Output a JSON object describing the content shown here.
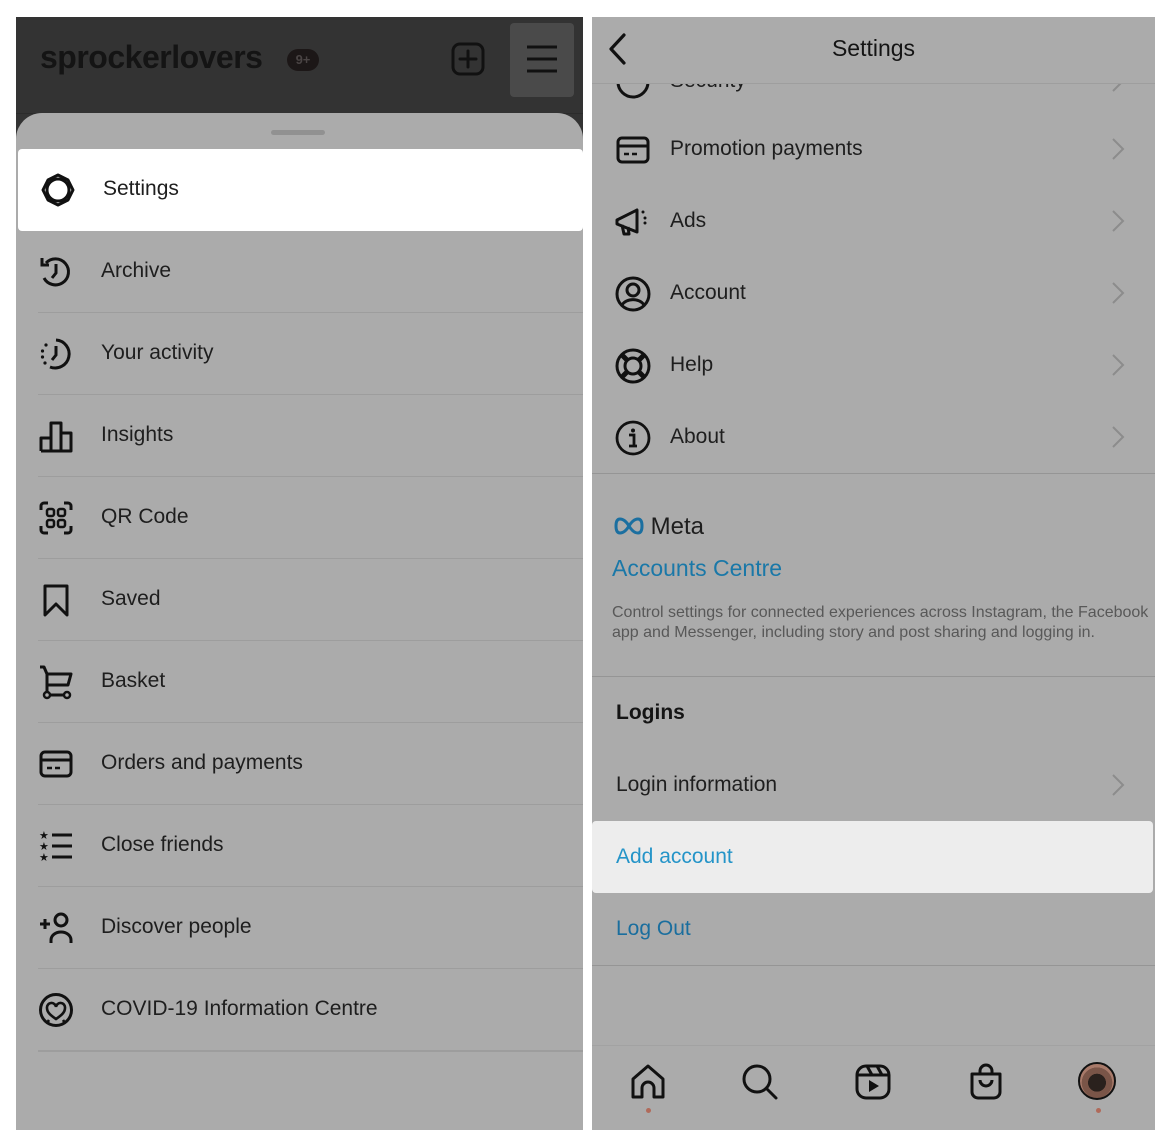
{
  "left_panel": {
    "username": "sprockerlovers",
    "notification_badge": "9+",
    "icons": {
      "new_post": "plus-square-icon",
      "menu": "hamburger-menu-icon"
    },
    "menu_items": [
      {
        "label": "Settings",
        "icon": "settings-gear-icon",
        "highlighted": true
      },
      {
        "label": "Archive",
        "icon": "archive-clock-icon"
      },
      {
        "label": "Your activity",
        "icon": "activity-clock-icon"
      },
      {
        "label": "Insights",
        "icon": "bar-chart-icon"
      },
      {
        "label": "QR Code",
        "icon": "qr-code-icon"
      },
      {
        "label": "Saved",
        "icon": "bookmark-icon"
      },
      {
        "label": "Basket",
        "icon": "cart-icon"
      },
      {
        "label": "Orders and payments",
        "icon": "card-icon"
      },
      {
        "label": "Close friends",
        "icon": "star-list-icon"
      },
      {
        "label": "Discover people",
        "icon": "add-person-icon"
      },
      {
        "label": "COVID-19 Information Centre",
        "icon": "heart-circle-icon"
      }
    ]
  },
  "right_panel": {
    "header": {
      "title": "Settings",
      "back_icon": "chevron-left-icon"
    },
    "partial_row_label": "Security",
    "rows": [
      {
        "label": "Promotion payments",
        "icon": "card-icon"
      },
      {
        "label": "Ads",
        "icon": "megaphone-icon"
      },
      {
        "label": "Account",
        "icon": "person-circle-icon"
      },
      {
        "label": "Help",
        "icon": "lifebuoy-icon"
      },
      {
        "label": "About",
        "icon": "info-icon"
      }
    ],
    "meta": {
      "logo_text": "Meta",
      "accounts_centre_label": "Accounts Centre",
      "description": "Control settings for connected experiences across Instagram, the Facebook app and Messenger, including story and post sharing and logging in."
    },
    "logins": {
      "heading": "Logins",
      "login_information": "Login information",
      "add_account": "Add account",
      "log_out": "Log Out"
    },
    "tab_bar": [
      "home-icon",
      "search-icon",
      "reels-icon",
      "shop-bag-icon",
      "profile-avatar"
    ],
    "colors": {
      "link_blue": "#2494c8",
      "dim_overlay_gray": "#ababab",
      "highlight": "#ededed"
    }
  }
}
